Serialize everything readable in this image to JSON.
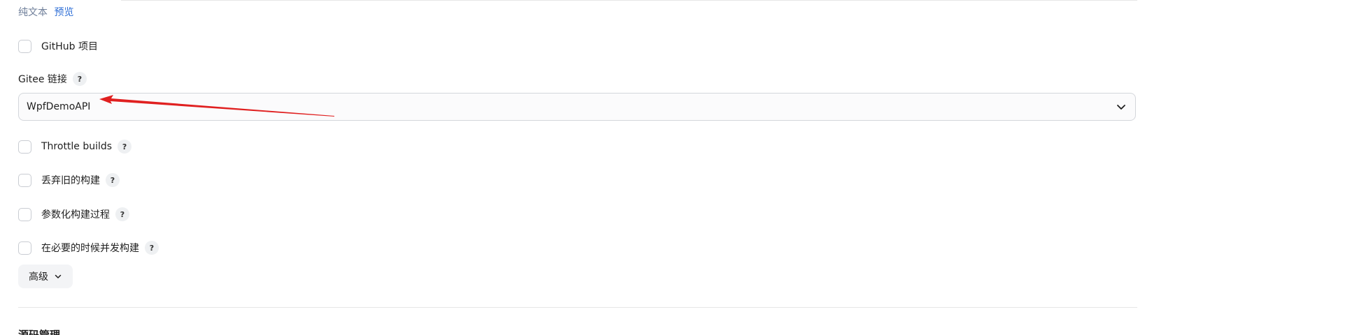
{
  "editor": {
    "plain_text_link": "纯文本",
    "preview_link": "预览"
  },
  "options": {
    "github_project": {
      "label": "GitHub 项目"
    },
    "throttle_builds": {
      "label": "Throttle builds",
      "help": "?"
    },
    "discard_old_builds": {
      "label": "丢弃旧的构建",
      "help": "?"
    },
    "parameterized": {
      "label": "参数化构建过程",
      "help": "?"
    },
    "concurrent_builds": {
      "label": "在必要的时候并发构建",
      "help": "?"
    }
  },
  "gitee": {
    "label": "Gitee 链接",
    "help": "?",
    "selected_value": "WpfDemoAPI"
  },
  "advanced": {
    "label": "高级"
  },
  "next_section": {
    "title": "源码管理"
  },
  "colors": {
    "annotation_arrow": "#e02020",
    "link": "#2f6fd6"
  },
  "icons": {
    "select_chevron": "chevron-down-icon",
    "advanced_chevron": "chevron-down-icon"
  }
}
